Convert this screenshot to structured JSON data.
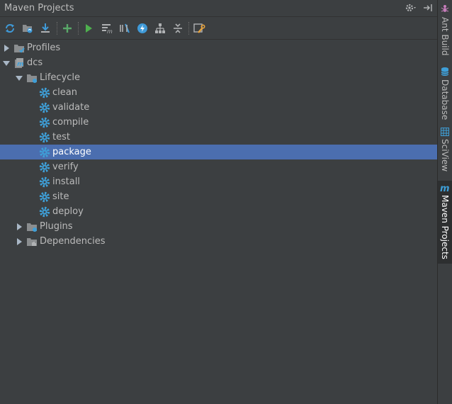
{
  "panel": {
    "title": "Maven Projects"
  },
  "toolbar": {
    "buttons": [
      {
        "name": "reimport-icon",
        "color": "#3f9ad8"
      },
      {
        "name": "generate-sources-icon",
        "color": "#3f9ad8"
      },
      {
        "name": "download-icon",
        "color": "#3f9ad8"
      },
      {
        "name": "add-icon",
        "color": "#59a869"
      },
      {
        "name": "run-icon",
        "color": "#4eb04e"
      },
      {
        "name": "execute-goal-icon",
        "color": "#afb1b3"
      },
      {
        "name": "toggle-offline-icon",
        "color": "#3f9ad8"
      },
      {
        "name": "skip-tests-icon",
        "color": "#3f9ad8"
      },
      {
        "name": "show-dependencies-icon",
        "color": "#afb1b3"
      },
      {
        "name": "collapse-all-icon",
        "color": "#afb1b3"
      },
      {
        "name": "maven-settings-icon",
        "color": "#e8a33d"
      }
    ]
  },
  "tree": {
    "profiles": "Profiles",
    "project": "dcs",
    "lifecycle": "Lifecycle",
    "goals": [
      "clean",
      "validate",
      "compile",
      "test",
      "package",
      "verify",
      "install",
      "site",
      "deploy"
    ],
    "selected": "package",
    "plugins": "Plugins",
    "dependencies": "Dependencies"
  },
  "sidebar": {
    "tabs": [
      {
        "label": "Ant Build",
        "icon": "ant-icon"
      },
      {
        "label": "Database",
        "icon": "database-icon"
      },
      {
        "label": "SciView",
        "icon": "table-icon"
      },
      {
        "label": "Maven Projects",
        "icon": "maven-icon",
        "active": true
      }
    ]
  },
  "colors": {
    "background": "#3c3f41",
    "selection": "#4b6eaf",
    "gear": "#3e9fd8"
  }
}
